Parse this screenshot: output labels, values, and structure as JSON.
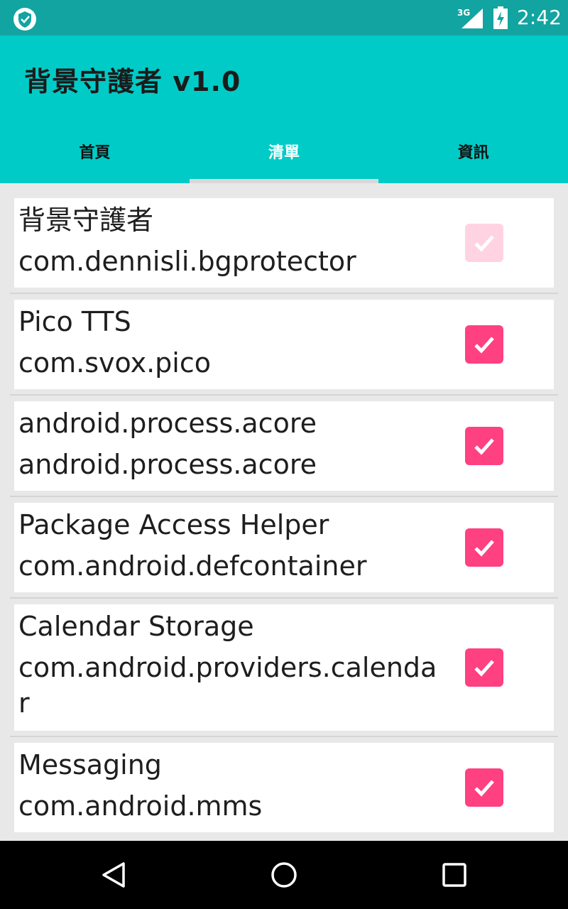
{
  "status_bar": {
    "network": "3G",
    "time": "2:42"
  },
  "app_bar": {
    "title": "背景守護者 v1.0"
  },
  "tabs": [
    {
      "label": "首頁",
      "active": false
    },
    {
      "label": "清單",
      "active": true
    },
    {
      "label": "資訊",
      "active": false
    }
  ],
  "items": [
    {
      "name": "背景守護者",
      "package": "com.dennisli.bgprotector",
      "checked": true,
      "enabled": false
    },
    {
      "name": "Pico TTS",
      "package": "com.svox.pico",
      "checked": true,
      "enabled": true
    },
    {
      "name": "android.process.acore",
      "package": "android.process.acore",
      "checked": true,
      "enabled": true
    },
    {
      "name": "Package Access Helper",
      "package": "com.android.defcontainer",
      "checked": true,
      "enabled": true
    },
    {
      "name": "Calendar Storage",
      "package": "com.android.providers.calendar",
      "checked": true,
      "enabled": true
    },
    {
      "name": "Messaging",
      "package": "com.android.mms",
      "checked": true,
      "enabled": true
    }
  ],
  "colors": {
    "primary": "#00cbc7",
    "status_bar": "#12a4a0",
    "accent": "#ff4081"
  }
}
